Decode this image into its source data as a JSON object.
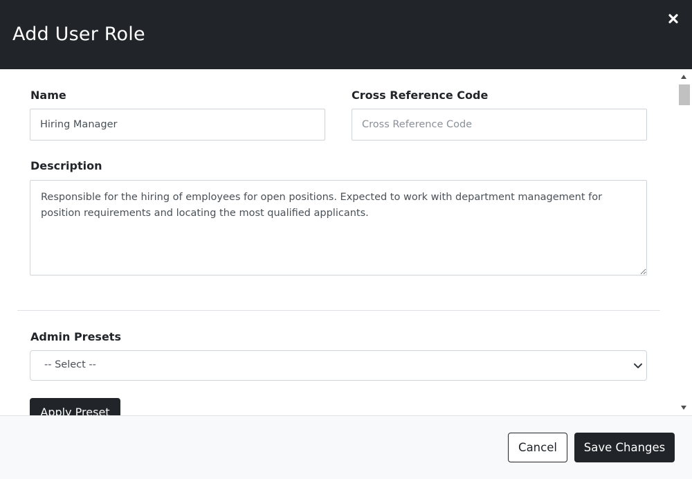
{
  "modal": {
    "title": "Add User Role",
    "close_icon": "close-icon"
  },
  "form": {
    "name": {
      "label": "Name",
      "value": "Hiring Manager",
      "placeholder": ""
    },
    "cross_reference_code": {
      "label": "Cross Reference Code",
      "value": "",
      "placeholder": "Cross Reference Code"
    },
    "description": {
      "label": "Description",
      "value": "Responsible for the hiring of employees for open positions. Expected to work with department management for position requirements and locating the most qualified applicants."
    },
    "admin_presets": {
      "label": "Admin Presets",
      "selected": "-- Select --",
      "chevron_icon": "chevron-down-icon"
    },
    "apply_preset_label": "Apply Preset"
  },
  "footer": {
    "cancel_label": "Cancel",
    "save_label": "Save Changes"
  },
  "colors": {
    "header_bg": "#212529",
    "primary_button": "#212529",
    "footer_bg": "#f8f9fa",
    "border": "#ced4da"
  }
}
